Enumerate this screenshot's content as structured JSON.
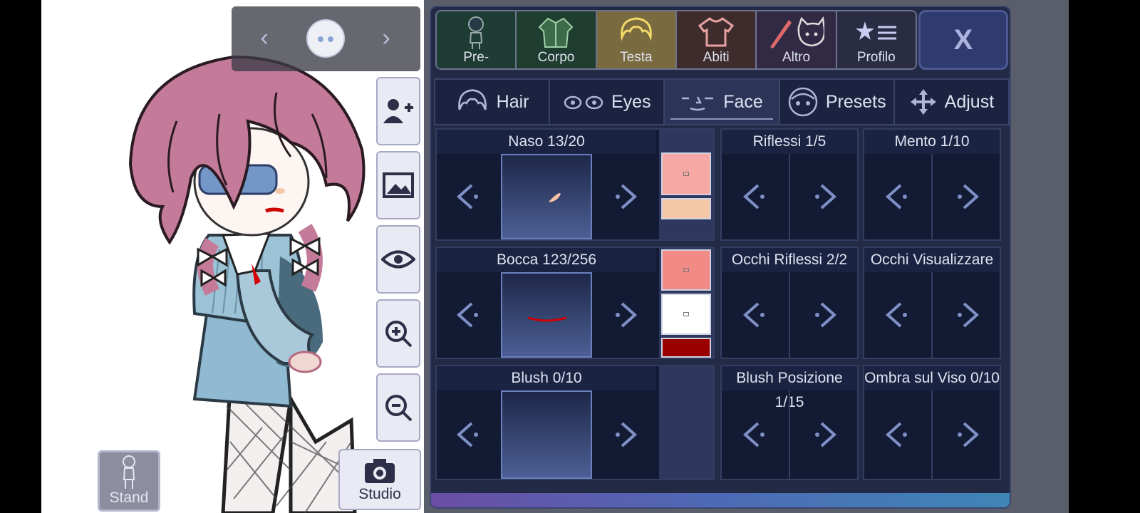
{
  "categories": [
    {
      "label": "Pre-",
      "icon": "body-preset-icon"
    },
    {
      "label": "Corpo",
      "icon": "jacket-icon"
    },
    {
      "label": "Testa",
      "icon": "hair-icon"
    },
    {
      "label": "Abiti",
      "icon": "shirt-icon"
    },
    {
      "label": "Altro",
      "icon": "sword-cat-icon"
    },
    {
      "label": "Profilo",
      "icon": "star-list-icon"
    }
  ],
  "active_category": "Testa",
  "close_label": "X",
  "subtabs": [
    {
      "label": "Hair",
      "icon": "hair-icon"
    },
    {
      "label": "Eyes",
      "icon": "eyes-icon"
    },
    {
      "label": "Face",
      "icon": "face-icon"
    },
    {
      "label": "Presets",
      "icon": "preset-face-icon"
    },
    {
      "label": "Adjust",
      "icon": "move-arrows-icon"
    }
  ],
  "active_subtab": "Face",
  "options": {
    "naso": "Naso 13/20",
    "bocca": "Bocca 123/256",
    "blush": "Blush 0/10",
    "riflessi": "Riflessi 1/5",
    "mento": "Mento 1/10",
    "occhi_riflessi": "Occhi Riflessi 2/2",
    "occhi_visualizzare": "Occhi Visualizzare",
    "blush_posizione": "Blush Posizione 1/15",
    "ombra_viso": "Ombra sul Viso 0/10"
  },
  "colors": {
    "naso": [
      "#f6a9a4",
      "#f4c7a6"
    ],
    "bocca": [
      "#f28a86",
      "#ffffff",
      "#9b0000"
    ],
    "accent_active_cat": "#7a6a3f"
  },
  "studio_label": "Studio",
  "stand_label": "Stand"
}
